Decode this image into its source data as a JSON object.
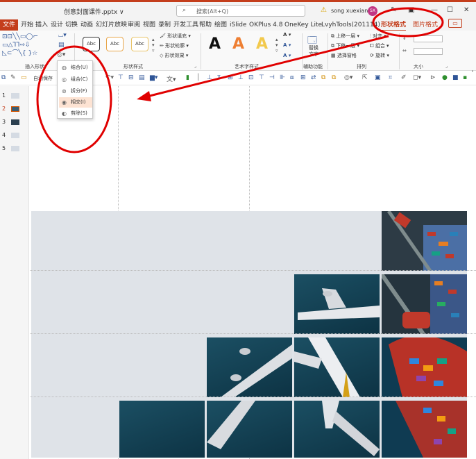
{
  "titlebar": {
    "file_name": "创意封面课件.pptx ∨",
    "search_placeholder": "搜索(Alt+Q)",
    "user_name": "song xuexian",
    "avatar_initials": "SX",
    "controls": [
      "—",
      "☐",
      "✕"
    ],
    "accent_color": "#c43e1c"
  },
  "tabs": {
    "file_label": "文件",
    "items": [
      "开始",
      "插入",
      "设计",
      "切换",
      "动画",
      "幻灯片放映",
      "审阅",
      "视图",
      "录制",
      "开发工具",
      "帮助",
      "绘图",
      "iSlide",
      "OKPlus 4.8",
      "OneKey Lite",
      "LvyhTools(201114)",
      "形状格式",
      "图片格式"
    ],
    "active": "形状格式",
    "comment_icon": "comment-icon"
  },
  "ribbon": {
    "groups": {
      "insert_shapes": "插入形状",
      "shape_styles": "形状样式",
      "art_text": "艺术字样式",
      "accessibility": "辅助功能",
      "arrange": "排列",
      "size": "大小"
    },
    "style_preview": "Abc",
    "fill": "形状填充 ▾",
    "outline": "形状轮廓 ▾",
    "effects": "形状效果 ▾",
    "art_letter": "A",
    "alt_text": "替换文字",
    "bring_forward": "上移一层 ▾",
    "send_backward": "下移一层 ▾",
    "selection_pane": "选择窗格",
    "align": "对齐 ▾",
    "group": "组合 ▾",
    "rotate": "旋转 ▾"
  },
  "merge_menu": {
    "items": [
      {
        "icon": "union-icon",
        "label": "结合(U)"
      },
      {
        "icon": "combine-icon",
        "label": "组合(C)"
      },
      {
        "icon": "fragment-icon",
        "label": "拆分(F)"
      },
      {
        "icon": "intersect-icon",
        "label": "相交(I)"
      },
      {
        "icon": "subtract-icon",
        "label": "剪除(S)"
      }
    ],
    "highlighted": "相交(I)"
  },
  "quick_toolbar": {
    "autosave_label": "自动保存"
  },
  "slides": {
    "numbers": [
      "1",
      "2",
      "3",
      "4",
      "5"
    ],
    "selected": "2"
  },
  "annotations": {
    "circle_color": "#e00000"
  }
}
